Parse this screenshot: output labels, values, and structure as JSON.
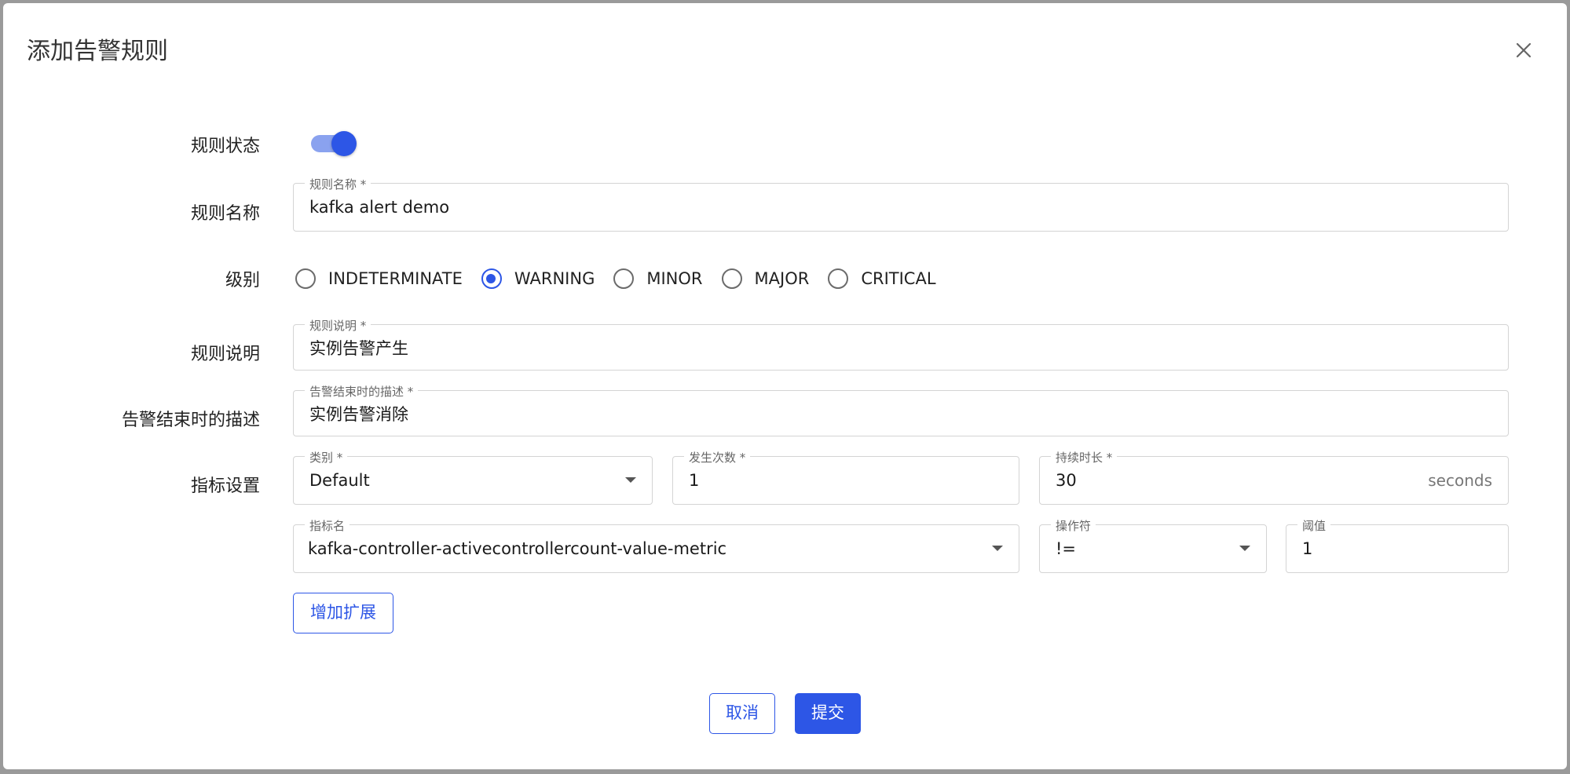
{
  "dialog": {
    "title": "添加告警规则"
  },
  "labels": {
    "status": "规则状态",
    "name": "规则名称",
    "level": "级别",
    "description": "规则说明",
    "end_description": "告警结束时的描述",
    "metric_settings": "指标设置"
  },
  "status": {
    "enabled": true
  },
  "name_field": {
    "label": "规则名称 *",
    "value": "kafka alert demo"
  },
  "levels": {
    "options": [
      "INDETERMINATE",
      "WARNING",
      "MINOR",
      "MAJOR",
      "CRITICAL"
    ],
    "selected": "WARNING"
  },
  "description_field": {
    "label": "规则说明 *",
    "value": "实例告警产生"
  },
  "end_description_field": {
    "label": "告警结束时的描述 *",
    "value": "实例告警消除"
  },
  "category_field": {
    "label": "类别 *",
    "value": "Default"
  },
  "occurrences_field": {
    "label": "发生次数 *",
    "value": "1"
  },
  "duration_field": {
    "label": "持续时长 *",
    "value": "30",
    "suffix": "seconds"
  },
  "metric_field": {
    "label": "指标名",
    "value": "kafka-controller-activecontrollercount-value-metric"
  },
  "operator_field": {
    "label": "操作符",
    "value": "!="
  },
  "threshold_field": {
    "label": "阈值",
    "value": "1"
  },
  "buttons": {
    "add_extension": "增加扩展",
    "cancel": "取消",
    "submit": "提交"
  },
  "colors": {
    "primary": "#2d56e6",
    "toggle_track": "#8aa2ef"
  }
}
